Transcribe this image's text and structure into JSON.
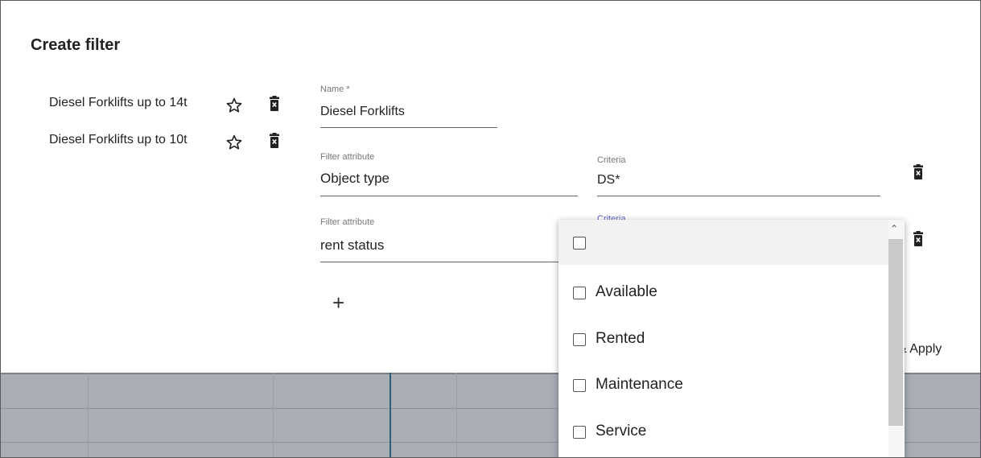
{
  "dialog": {
    "title": "Create filter"
  },
  "saved_filters": [
    {
      "label": "Diesel Forklifts up to 14t",
      "star_icon": "star-outline-icon",
      "delete_icon": "trash-icon"
    },
    {
      "label": "Diesel Forklifts up to 10t",
      "star_icon": "star-outline-icon",
      "delete_icon": "trash-icon"
    }
  ],
  "name_field": {
    "label": "Name *",
    "value": "Diesel Forklifts"
  },
  "rules": [
    {
      "attribute_label": "Filter attribute",
      "attribute_value": "Object type",
      "criteria_label": "Criteria",
      "criteria_value": "DS*"
    },
    {
      "attribute_label": "Filter attribute",
      "attribute_value": "rent status",
      "criteria_label": "Criteria",
      "criteria_value": ""
    }
  ],
  "add_rule": {
    "symbol": "+"
  },
  "apply_button": {
    "label": "& Apply"
  },
  "criteria_dropdown": {
    "options": [
      {
        "label": "",
        "checked": false
      },
      {
        "label": "Available",
        "checked": false
      },
      {
        "label": "Rented",
        "checked": false
      },
      {
        "label": "Maintenance",
        "checked": false
      },
      {
        "label": "Service",
        "checked": false
      }
    ]
  },
  "colors": {
    "active_label": "#5b5ec9",
    "overlay_grid": "#a9adb5"
  }
}
